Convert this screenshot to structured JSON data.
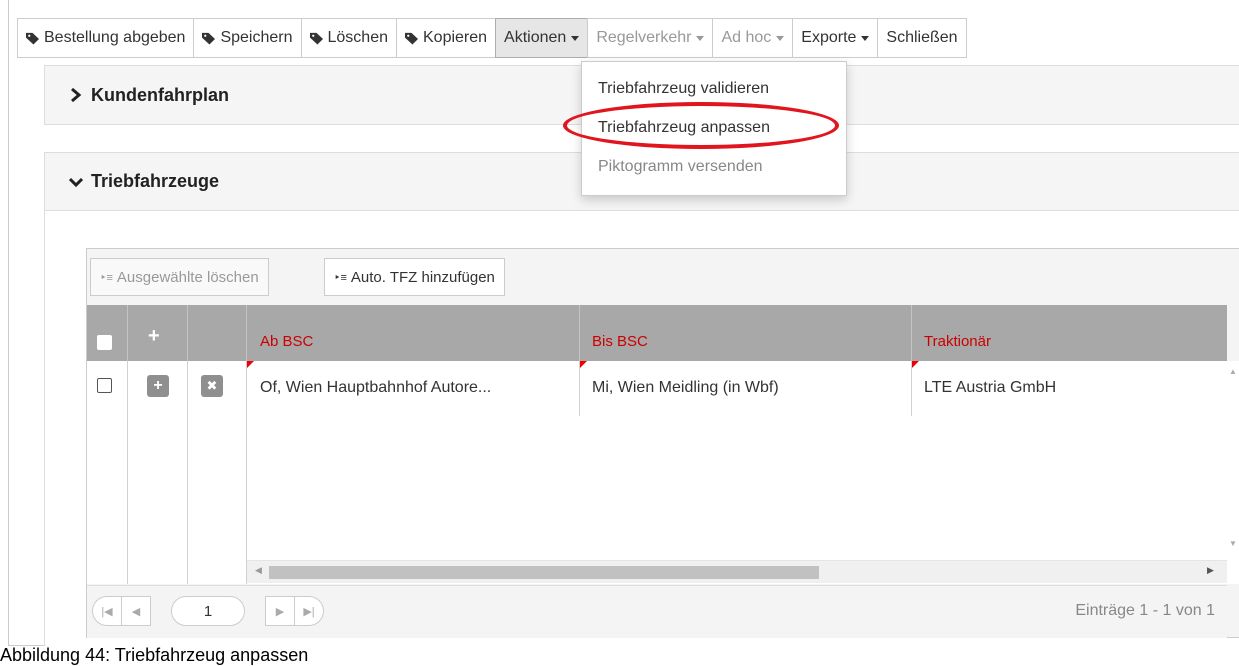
{
  "toolbar": {
    "items": [
      {
        "label": "Bestellung abgeben",
        "icon": "tag-icon"
      },
      {
        "label": "Speichern",
        "icon": "tag-icon"
      },
      {
        "label": "Löschen",
        "icon": "tag-icon"
      },
      {
        "label": "Kopieren",
        "icon": "tag-icon"
      },
      {
        "label": "Aktionen",
        "dropdown": true,
        "state": "open"
      },
      {
        "label": "Regelverkehr",
        "dropdown": true,
        "state": "disabled"
      },
      {
        "label": "Ad hoc",
        "dropdown": true,
        "state": "disabled"
      },
      {
        "label": "Exporte",
        "dropdown": true
      },
      {
        "label": "Schließen"
      }
    ]
  },
  "dropdown": {
    "items": [
      {
        "label": "Triebfahrzeug validieren"
      },
      {
        "label": "Triebfahrzeug anpassen",
        "highlighted": true
      },
      {
        "label": "Piktogramm versenden",
        "state": "disabled"
      }
    ],
    "highlight_color": "#e0151d"
  },
  "panels": {
    "kundenfahrplan": {
      "title": "Kundenfahrplan",
      "state": "collapsed"
    },
    "triebfahrzeuge": {
      "title": "Triebfahrzeuge",
      "state": "expanded"
    }
  },
  "grid": {
    "buttons": {
      "delete_selected": "Ausgewählte löschen",
      "add_auto_tfz": "Auto. TFZ hinzufügen"
    },
    "columns": [
      "Ab BSC",
      "Bis BSC",
      "Traktionär"
    ],
    "header_color": "#cc0000",
    "rows": [
      {
        "ab_bsc": "Of, Wien Hauptbahnhof Autore...",
        "bis_bsc": "Mi, Wien Meidling (in Wbf)",
        "traktionaer": "LTE Austria GmbH"
      }
    ],
    "pager": {
      "page": "1",
      "summary": "Einträge 1 - 1 von 1"
    }
  },
  "caption": "Abbildung 44: Triebfahrzeug anpassen"
}
